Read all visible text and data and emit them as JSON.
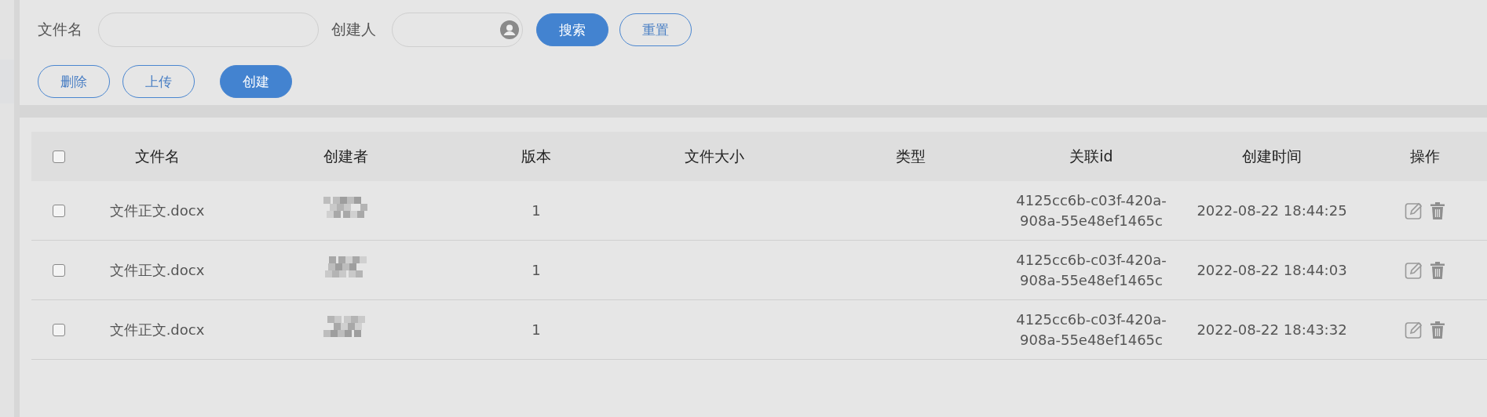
{
  "filters": [
    {
      "label": "文件名",
      "kind": "text"
    },
    {
      "label": "创建人",
      "kind": "person"
    }
  ],
  "filter_buttons": [
    {
      "label": "搜索",
      "kind": "primary"
    },
    {
      "label": "重置",
      "kind": "outline"
    }
  ],
  "action_buttons": [
    {
      "label": "删除",
      "kind": "outline"
    },
    {
      "label": "上传",
      "kind": "outline"
    },
    {
      "label": "创建",
      "kind": "primary"
    }
  ],
  "table": {
    "select_all": {
      "checked": false
    },
    "columns": [
      "文件名",
      "创建者",
      "版本",
      "文件大小",
      "类型",
      "关联id",
      "创建时间",
      "操作"
    ],
    "rows": [
      {
        "selected": false,
        "file_name": "文件正文.docx",
        "creator_obscured": true,
        "version": "1",
        "related_id": "4125cc6b-c03f-420a-908a-55e48ef1465c",
        "created_at": "2022-08-22 18:44:25"
      },
      {
        "selected": false,
        "file_name": "文件正文.docx",
        "creator_obscured": true,
        "version": "1",
        "related_id": "4125cc6b-c03f-420a-908a-55e48ef1465c",
        "created_at": "2022-08-22 18:44:03"
      },
      {
        "selected": false,
        "file_name": "文件正文.docx",
        "creator_obscured": true,
        "version": "1",
        "related_id": "4125cc6b-c03f-420a-908a-55e48ef1465c",
        "created_at": "2022-08-22 18:43:32"
      }
    ]
  }
}
